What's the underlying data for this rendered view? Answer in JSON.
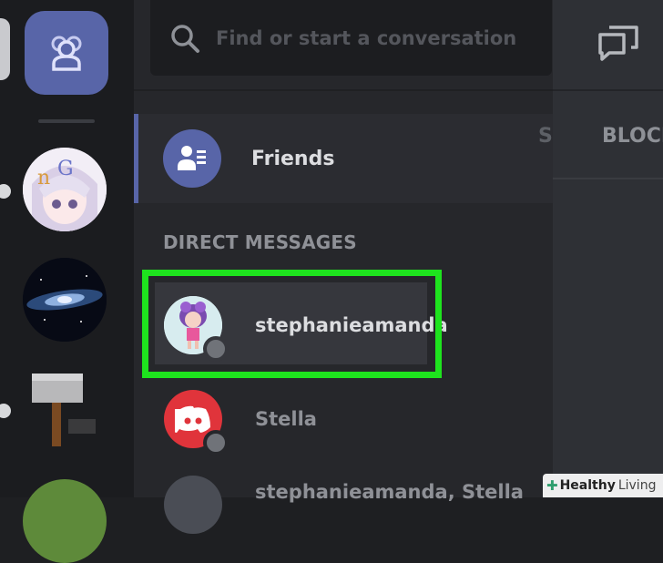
{
  "search": {
    "placeholder": "Find or start a conversation"
  },
  "nav": {
    "friends_label": "Friends"
  },
  "direct_messages": {
    "heading": "DIRECT MESSAGES",
    "items": [
      {
        "name": "stephanieamanda",
        "status": "offline"
      },
      {
        "name": "Stella",
        "status": "offline"
      },
      {
        "name": "stephanieamanda, Stella"
      }
    ]
  },
  "main": {
    "tabs": [
      "S",
      "BLOCK"
    ]
  },
  "watermark": {
    "brand": "Healthy",
    "brand2": "Living"
  },
  "colors": {
    "accent": "#5865a8",
    "highlight": "#1ee31e",
    "discord_red": "#e0343b"
  }
}
